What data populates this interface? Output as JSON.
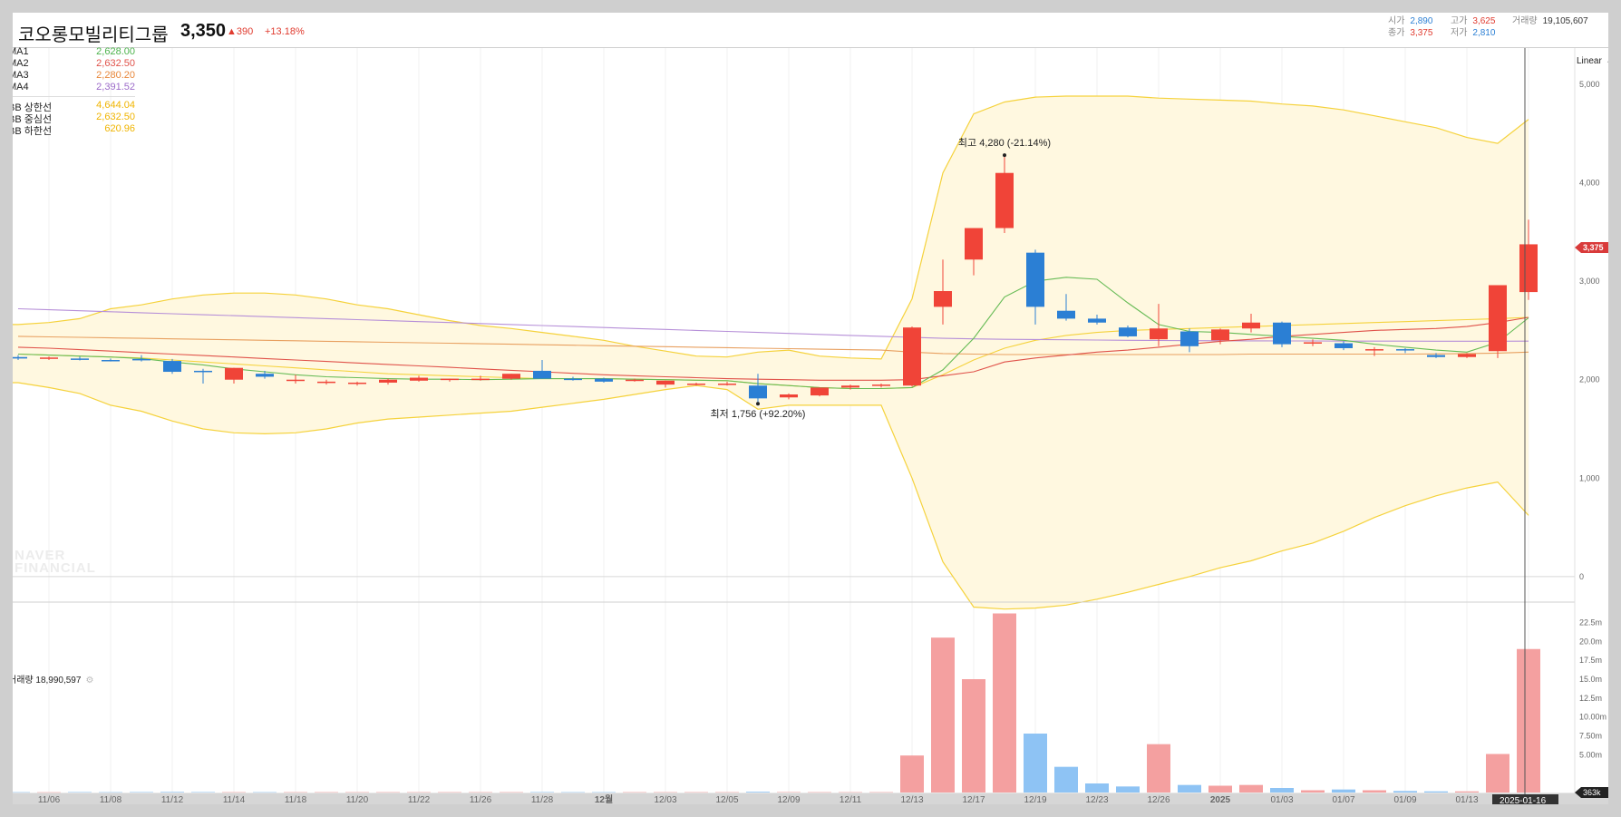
{
  "header": {
    "stock_name": "코오롱모빌리티그룹",
    "price": "3,350",
    "change": "▲390",
    "change_rate": "+13.18%",
    "ohlc": [
      {
        "label": "시가",
        "value": "2,890",
        "color": "#2b7fd4"
      },
      {
        "label": "고가",
        "value": "3,625",
        "color": "#e03b2f"
      },
      {
        "label": "거래량",
        "value": "19,105,607",
        "color": "#333333"
      },
      {
        "label": "종가",
        "value": "3,375",
        "color": "#e03b2f"
      },
      {
        "label": "저가",
        "value": "2,810",
        "color": "#2b7fd4"
      }
    ]
  },
  "legend": {
    "ma": [
      {
        "name": "MA1",
        "value": "2,628.00",
        "color": "#4db34d"
      },
      {
        "name": "MA2",
        "value": "2,632.50",
        "color": "#e0524a"
      },
      {
        "name": "MA3",
        "value": "2,280.20",
        "color": "#e8873a"
      },
      {
        "name": "MA4",
        "value": "2,391.52",
        "color": "#9c6bc9"
      }
    ],
    "bb": [
      {
        "name": "BB 상한선",
        "value": "4,644.04",
        "color": "#f0b400"
      },
      {
        "name": "BB 중심선",
        "value": "2,632.50",
        "color": "#f0b400"
      },
      {
        "name": "BB 하한선",
        "value": "620.96",
        "color": "#f0b400"
      }
    ]
  },
  "scale_label": "Linear",
  "watermark": [
    "NAVER",
    "FINANCIAL"
  ],
  "volume_label": "거래량 18,990,597",
  "annotations": {
    "high": "최고 4,280 (-21.14%)",
    "low": "최저 1,756 (+92.20%)"
  },
  "price_tag": "3,375",
  "volume_tag": "363k",
  "date_tag": "2025-01-16",
  "colors": {
    "up": "#f04438",
    "down": "#2b7fd4",
    "up_vol": "#f4a0a0",
    "down_vol": "#8ec3f4",
    "band_fill": "#fff8e0",
    "band_line": "#f5d23c"
  },
  "chart_data": {
    "type": "candlestick",
    "price_ylim": [
      -250,
      5000
    ],
    "price_ticks": [
      "5,000",
      "4,000",
      "3,000",
      "2,000",
      "1,000",
      "0"
    ],
    "volume_ylim": [
      0,
      24000000
    ],
    "volume_ticks": [
      "22.5m",
      "20.0m",
      "17.5m",
      "15.0m",
      "12.5m",
      "10.00m",
      "7.50m",
      "5.00m"
    ],
    "x_ticks": [
      "11/06",
      "11/08",
      "11/12",
      "11/14",
      "11/18",
      "11/20",
      "11/22",
      "11/26",
      "11/28",
      "12월",
      "12/03",
      "12/05",
      "12/09",
      "12/11",
      "12/13",
      "12/17",
      "12/19",
      "12/23",
      "12/26",
      "2025",
      "01/03",
      "01/07",
      "01/09",
      "01/13",
      "01"
    ],
    "candles": [
      {
        "o": 2230,
        "h": 2250,
        "l": 2200,
        "c": 2215
      },
      {
        "o": 2220,
        "h": 2235,
        "l": 2200,
        "c": 2225
      },
      {
        "o": 2215,
        "h": 2235,
        "l": 2195,
        "c": 2210
      },
      {
        "o": 2200,
        "h": 2215,
        "l": 2185,
        "c": 2195
      },
      {
        "o": 2210,
        "h": 2250,
        "l": 2185,
        "c": 2200
      },
      {
        "o": 2190,
        "h": 2210,
        "l": 2060,
        "c": 2080
      },
      {
        "o": 2090,
        "h": 2110,
        "l": 1960,
        "c": 2080
      },
      {
        "o": 2000,
        "h": 2120,
        "l": 1960,
        "c": 2120
      },
      {
        "o": 2060,
        "h": 2090,
        "l": 2010,
        "c": 2030
      },
      {
        "o": 2000,
        "h": 2050,
        "l": 1960,
        "c": 2000
      },
      {
        "o": 1970,
        "h": 2000,
        "l": 1950,
        "c": 1980
      },
      {
        "o": 1960,
        "h": 1980,
        "l": 1940,
        "c": 1970
      },
      {
        "o": 1970,
        "h": 2010,
        "l": 1950,
        "c": 2000
      },
      {
        "o": 1990,
        "h": 2040,
        "l": 1980,
        "c": 2020
      },
      {
        "o": 2000,
        "h": 2010,
        "l": 1980,
        "c": 2010
      },
      {
        "o": 2010,
        "h": 2040,
        "l": 1990,
        "c": 2010
      },
      {
        "o": 2010,
        "h": 2060,
        "l": 2000,
        "c": 2060
      },
      {
        "o": 2090,
        "h": 2200,
        "l": 2010,
        "c": 2010
      },
      {
        "o": 2010,
        "h": 2030,
        "l": 1990,
        "c": 2000
      },
      {
        "o": 2010,
        "h": 2020,
        "l": 1970,
        "c": 1980
      },
      {
        "o": 1990,
        "h": 2010,
        "l": 1980,
        "c": 2000
      },
      {
        "o": 1950,
        "h": 1990,
        "l": 1920,
        "c": 1990
      },
      {
        "o": 1960,
        "h": 1970,
        "l": 1940,
        "c": 1960
      },
      {
        "o": 1960,
        "h": 1980,
        "l": 1940,
        "c": 1960
      },
      {
        "o": 1940,
        "h": 2060,
        "l": 1756,
        "c": 1810
      },
      {
        "o": 1820,
        "h": 1860,
        "l": 1800,
        "c": 1850
      },
      {
        "o": 1840,
        "h": 1920,
        "l": 1830,
        "c": 1920
      },
      {
        "o": 1920,
        "h": 1950,
        "l": 1900,
        "c": 1940
      },
      {
        "o": 1940,
        "h": 1960,
        "l": 1920,
        "c": 1950
      },
      {
        "o": 1940,
        "h": 2540,
        "l": 1930,
        "c": 2530
      },
      {
        "o": 2740,
        "h": 3220,
        "l": 2560,
        "c": 2900
      },
      {
        "o": 3220,
        "h": 3540,
        "l": 3060,
        "c": 3540
      },
      {
        "o": 3540,
        "h": 4280,
        "l": 3490,
        "c": 4100
      },
      {
        "o": 3290,
        "h": 3320,
        "l": 2560,
        "c": 2740
      },
      {
        "o": 2700,
        "h": 2870,
        "l": 2600,
        "c": 2620
      },
      {
        "o": 2620,
        "h": 2660,
        "l": 2560,
        "c": 2580
      },
      {
        "o": 2530,
        "h": 2550,
        "l": 2430,
        "c": 2440
      },
      {
        "o": 2410,
        "h": 2770,
        "l": 2340,
        "c": 2520
      },
      {
        "o": 2490,
        "h": 2520,
        "l": 2280,
        "c": 2340
      },
      {
        "o": 2400,
        "h": 2520,
        "l": 2360,
        "c": 2510
      },
      {
        "o": 2520,
        "h": 2670,
        "l": 2480,
        "c": 2580
      },
      {
        "o": 2580,
        "h": 2590,
        "l": 2330,
        "c": 2360
      },
      {
        "o": 2370,
        "h": 2410,
        "l": 2340,
        "c": 2380
      },
      {
        "o": 2370,
        "h": 2390,
        "l": 2300,
        "c": 2320
      },
      {
        "o": 2300,
        "h": 2330,
        "l": 2240,
        "c": 2310
      },
      {
        "o": 2310,
        "h": 2320,
        "l": 2270,
        "c": 2300
      },
      {
        "o": 2250,
        "h": 2270,
        "l": 2220,
        "c": 2230
      },
      {
        "o": 2230,
        "h": 2270,
        "l": 2220,
        "c": 2260
      },
      {
        "o": 2290,
        "h": 2960,
        "l": 2220,
        "c": 2960
      },
      {
        "o": 2890,
        "h": 3625,
        "l": 2810,
        "c": 3375
      }
    ],
    "volumes": [
      0.05,
      0.04,
      0.06,
      0.05,
      0.06,
      0.08,
      0.06,
      0.05,
      0.05,
      0.05,
      0.05,
      0.05,
      0.05,
      0.05,
      0.05,
      0.05,
      0.05,
      0.06,
      0.05,
      0.05,
      0.05,
      0.05,
      0.05,
      0.05,
      0.1,
      0.06,
      0.05,
      0.05,
      0.05,
      4.9,
      20.5,
      15.0,
      23.7,
      7.8,
      3.4,
      1.2,
      0.8,
      6.4,
      1.0,
      0.9,
      1.0,
      0.6,
      0.3,
      0.4,
      0.3,
      0.2,
      0.15,
      0.15,
      5.1,
      18.99
    ],
    "ma1": [
      2260,
      2250,
      2240,
      2230,
      2215,
      2180,
      2150,
      2110,
      2080,
      2050,
      2030,
      2020,
      2010,
      2005,
      2005,
      2000,
      2005,
      2010,
      2010,
      2010,
      2005,
      2000,
      1995,
      1990,
      1960,
      1940,
      1920,
      1910,
      1910,
      1920,
      2100,
      2420,
      2840,
      3000,
      3040,
      3020,
      2780,
      2560,
      2490,
      2480,
      2460,
      2440,
      2420,
      2400,
      2360,
      2330,
      2300,
      2280,
      2380,
      2628
    ],
    "ma2": [
      2330,
      2320,
      2305,
      2290,
      2275,
      2260,
      2245,
      2230,
      2215,
      2200,
      2185,
      2170,
      2155,
      2140,
      2125,
      2110,
      2095,
      2080,
      2065,
      2050,
      2040,
      2030,
      2020,
      2010,
      2005,
      2000,
      1995,
      1995,
      1995,
      2000,
      2040,
      2080,
      2180,
      2220,
      2250,
      2280,
      2300,
      2330,
      2360,
      2390,
      2410,
      2440,
      2460,
      2480,
      2500,
      2510,
      2520,
      2540,
      2580,
      2632.5
    ],
    "ma3": [
      2440,
      2435,
      2430,
      2425,
      2420,
      2415,
      2410,
      2405,
      2400,
      2395,
      2390,
      2385,
      2380,
      2375,
      2370,
      2365,
      2360,
      2355,
      2350,
      2345,
      2340,
      2335,
      2330,
      2325,
      2320,
      2315,
      2310,
      2305,
      2300,
      2280,
      2265,
      2260,
      2255,
      2255,
      2255,
      2255,
      2255,
      2255,
      2255,
      2255,
      2260,
      2260,
      2260,
      2260,
      2260,
      2260,
      2262,
      2265,
      2270,
      2280.2
    ],
    "ma4": [
      2720,
      2710,
      2700,
      2690,
      2680,
      2670,
      2660,
      2650,
      2640,
      2630,
      2620,
      2610,
      2600,
      2590,
      2580,
      2570,
      2560,
      2550,
      2540,
      2530,
      2520,
      2510,
      2500,
      2490,
      2480,
      2470,
      2460,
      2450,
      2440,
      2430,
      2420,
      2415,
      2410,
      2408,
      2405,
      2403,
      2400,
      2398,
      2396,
      2395,
      2394,
      2393,
      2393,
      2392,
      2392,
      2392,
      2391,
      2391,
      2391,
      2391.52
    ],
    "bb_upper": [
      2560,
      2580,
      2620,
      2720,
      2760,
      2820,
      2860,
      2880,
      2880,
      2860,
      2820,
      2760,
      2720,
      2660,
      2600,
      2550,
      2520,
      2480,
      2440,
      2400,
      2340,
      2290,
      2240,
      2230,
      2280,
      2300,
      2240,
      2220,
      2210,
      2820,
      4100,
      4700,
      4820,
      4870,
      4880,
      4880,
      4880,
      4860,
      4850,
      4840,
      4830,
      4800,
      4780,
      4740,
      4680,
      4620,
      4560,
      4460,
      4400,
      4644.04
    ],
    "bb_middle": [
      2260,
      2250,
      2240,
      2230,
      2220,
      2200,
      2180,
      2160,
      2140,
      2120,
      2100,
      2080,
      2060,
      2050,
      2040,
      2030,
      2020,
      2010,
      2010,
      2010,
      2005,
      2000,
      1995,
      1990,
      1960,
      1940,
      1920,
      1910,
      1910,
      1920,
      2050,
      2200,
      2320,
      2400,
      2450,
      2480,
      2500,
      2510,
      2520,
      2530,
      2540,
      2550,
      2560,
      2570,
      2580,
      2590,
      2600,
      2610,
      2620,
      2632.5
    ],
    "bb_lower": [
      1970,
      1920,
      1860,
      1740,
      1680,
      1580,
      1500,
      1460,
      1450,
      1460,
      1500,
      1560,
      1600,
      1620,
      1640,
      1660,
      1680,
      1720,
      1760,
      1800,
      1850,
      1900,
      1940,
      1900,
      1700,
      1740,
      1740,
      1740,
      1740,
      1000,
      150,
      -310,
      -330,
      -320,
      -290,
      -230,
      -160,
      -80,
      0,
      90,
      160,
      260,
      340,
      460,
      600,
      720,
      820,
      900,
      960,
      620.96
    ]
  }
}
